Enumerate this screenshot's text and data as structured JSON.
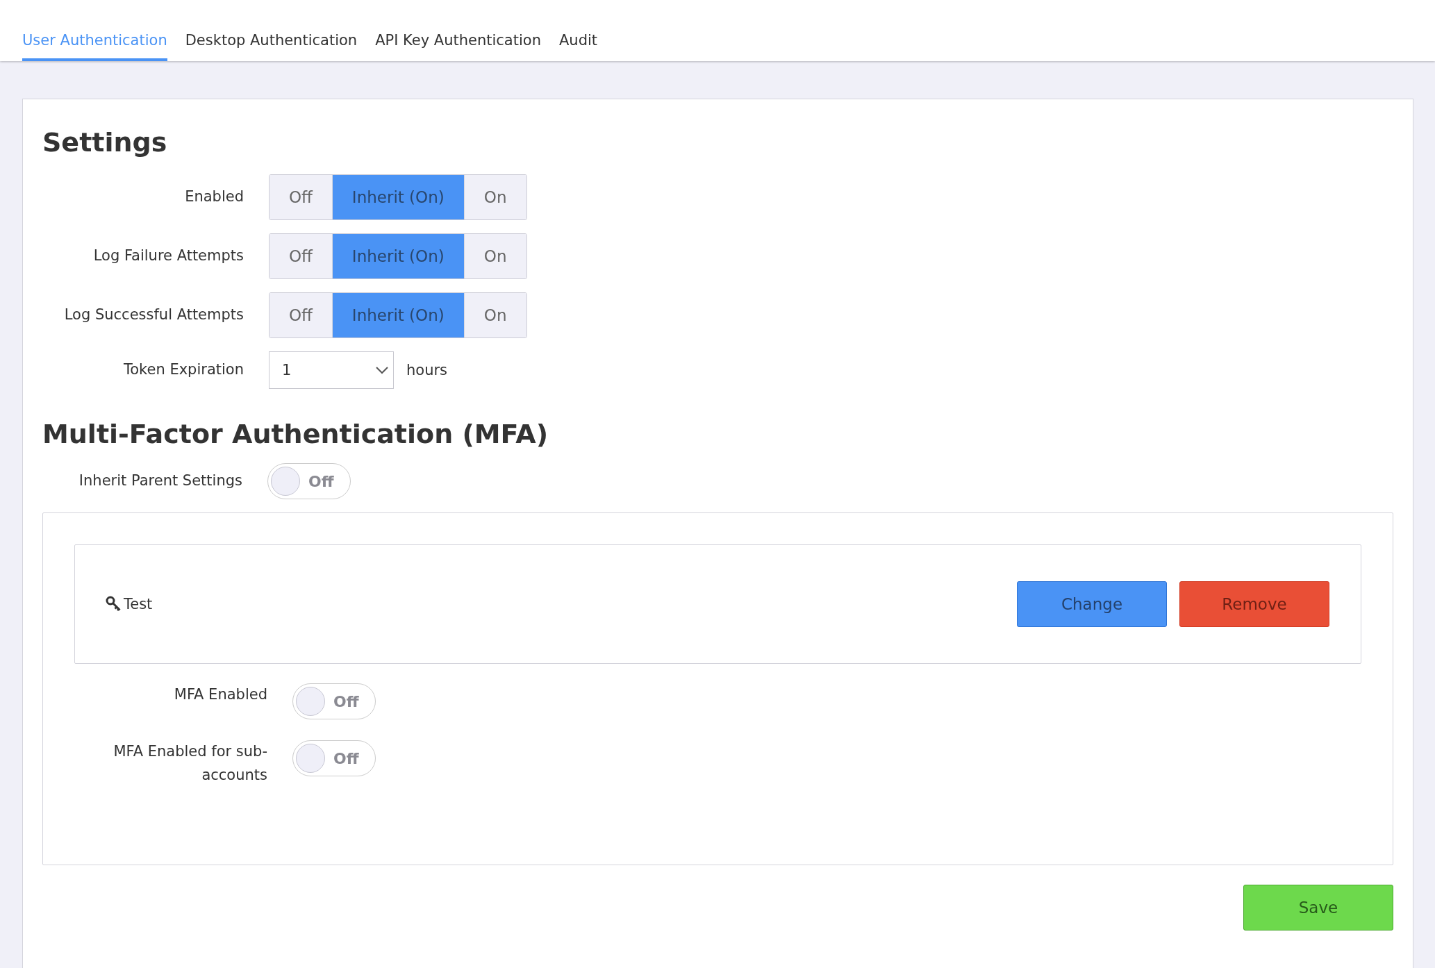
{
  "tabs": [
    {
      "label": "User Authentication",
      "selected": true
    },
    {
      "label": "Desktop Authentication",
      "selected": false
    },
    {
      "label": "API Key Authentication",
      "selected": false
    },
    {
      "label": "Audit",
      "selected": false
    }
  ],
  "settings": {
    "title": "Settings",
    "rows": [
      {
        "kind": "segmented",
        "label": "Enabled",
        "options": [
          {
            "label": "Off",
            "selected": false
          },
          {
            "label": "Inherit (On)",
            "selected": true
          },
          {
            "label": "On",
            "selected": false
          }
        ]
      },
      {
        "kind": "segmented",
        "label": "Log Failure Attempts",
        "options": [
          {
            "label": "Off",
            "selected": false
          },
          {
            "label": "Inherit (On)",
            "selected": true
          },
          {
            "label": "On",
            "selected": false
          }
        ]
      },
      {
        "kind": "segmented",
        "label": "Log Successful Attempts",
        "options": [
          {
            "label": "Off",
            "selected": false
          },
          {
            "label": "Inherit (On)",
            "selected": true
          },
          {
            "label": "On",
            "selected": false
          }
        ]
      },
      {
        "kind": "select",
        "label": "Token Expiration",
        "value": "1",
        "unit": "hours"
      }
    ]
  },
  "mfa": {
    "title": "Multi-Factor Authentication (MFA)",
    "inherit": {
      "label": "Inherit Parent Settings",
      "on": false,
      "text": "Off"
    },
    "key": {
      "name": "Test",
      "buttons": [
        {
          "label": "Change",
          "kind": "primary"
        },
        {
          "label": "Remove",
          "kind": "danger"
        }
      ]
    },
    "toggles": [
      {
        "label": "MFA Enabled",
        "on": false,
        "text": "Off"
      },
      {
        "label": "MFA Enabled for sub-accounts",
        "on": false,
        "text": "Off"
      }
    ]
  },
  "save": {
    "label": "Save"
  }
}
